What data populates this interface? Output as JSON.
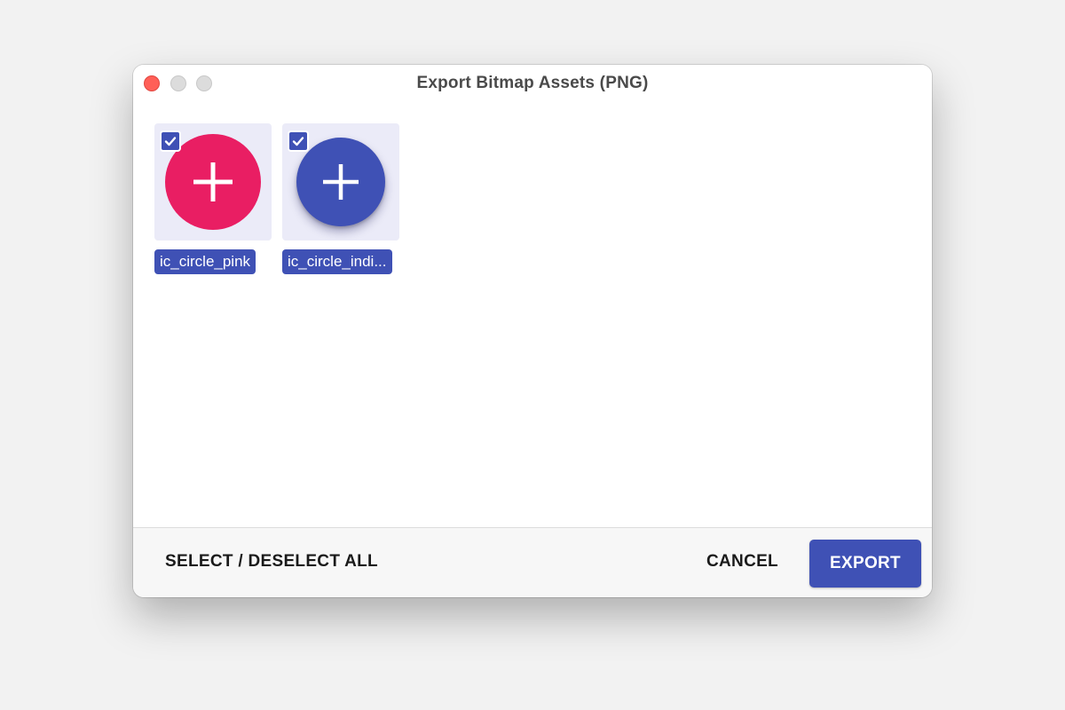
{
  "window": {
    "title": "Export Bitmap Assets (PNG)",
    "controls": [
      "close",
      "minimize",
      "maximize"
    ]
  },
  "assets": [
    {
      "name": "ic_circle_pink",
      "checked": true,
      "color": "#e91e63",
      "icon": "plus-icon"
    },
    {
      "name": "ic_circle_indi...",
      "checked": true,
      "color": "#3f51b5",
      "icon": "plus-icon"
    }
  ],
  "footer": {
    "select_all_label": "SELECT / DESELECT ALL",
    "cancel_label": "CANCEL",
    "export_label": "EXPORT"
  },
  "colors": {
    "accent": "#3f51b5",
    "close_button": "#ff5f57",
    "thumb_background": "#ebebf8"
  }
}
